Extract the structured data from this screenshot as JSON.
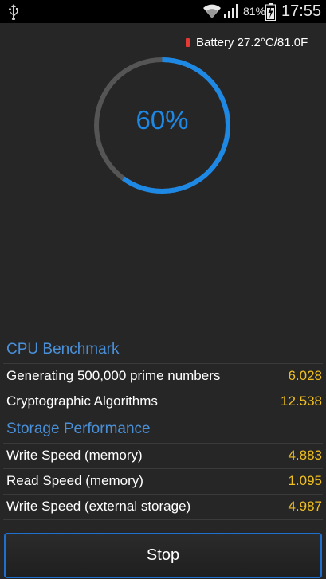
{
  "status_bar": {
    "battery_percent": "81%",
    "time": "17:55",
    "icons": [
      "usb-icon",
      "wifi-icon",
      "signal-icon",
      "battery-charging-icon"
    ]
  },
  "battery": {
    "temperature_text": "Battery 27.2°C/81.0F",
    "indicator_color": "#e53935"
  },
  "progress": {
    "label": "60%",
    "value": 0.6,
    "color": "#1e88e5",
    "track_color": "#555555"
  },
  "cpu": {
    "title": "CPU Benchmark",
    "rows": [
      {
        "label": "Generating 500,000 prime numbers",
        "value": "6.028"
      },
      {
        "label": "Cryptographic Algorithms",
        "value": "12.538"
      }
    ]
  },
  "storage": {
    "title": "Storage Performance",
    "rows": [
      {
        "label": "Write Speed (memory)",
        "value": "4.883"
      },
      {
        "label": "Read Speed (memory)",
        "value": "1.095"
      },
      {
        "label": "Write Speed (external storage)",
        "value": "4.987"
      }
    ]
  },
  "actions": {
    "stop_label": "Stop"
  },
  "colors": {
    "accent": "#4a90d9",
    "value": "#f0c020",
    "background": "#262626"
  }
}
